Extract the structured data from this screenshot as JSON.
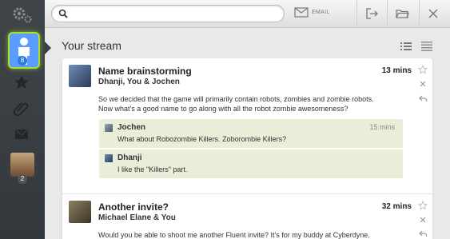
{
  "search": {
    "placeholder": ""
  },
  "toolbar": {
    "email_label": "EMAIL"
  },
  "sidebar": {
    "active_badge": "8",
    "avatar_badge": "2"
  },
  "stream": {
    "title": "Your stream"
  },
  "posts": [
    {
      "title": "Name brainstorming",
      "participants": "Dhanji, You & Jochen",
      "time": "13 mins",
      "body_line1": "So we decided that the game will primarily contain robots, zombies and zombie robots.",
      "body_line2": "Now what's a good name to go along with all the robot zombie awesomeness?",
      "comments": [
        {
          "name": "Jochen",
          "time": "15 mins",
          "text": "What about Robozombie Killers. Zoborombie Killers?"
        },
        {
          "name": "Dhanji",
          "time": "",
          "text": "I like the \"Killers\" part."
        }
      ]
    },
    {
      "title": "Another invite?",
      "participants": "Michael Elane & You",
      "time": "32 mins",
      "body_line1": "Would you be able to shoot me another Fluent invite? It's for my buddy at Cyberdyne."
    }
  ],
  "colors": {
    "accent_green": "#a6e02a",
    "active_blue": "#5a9cff",
    "comment_bg": "#e8eed8",
    "sidebar_bg": "#3a3f44"
  },
  "icons": [
    "gear-icon",
    "person-icon",
    "star-icon",
    "paperclip-icon",
    "mail-icon",
    "search-icon",
    "email-icon",
    "sign-out-icon",
    "folder-icon",
    "close-icon",
    "list-view-icon",
    "compact-view-icon",
    "star-outline-icon",
    "dismiss-icon",
    "reply-icon"
  ]
}
